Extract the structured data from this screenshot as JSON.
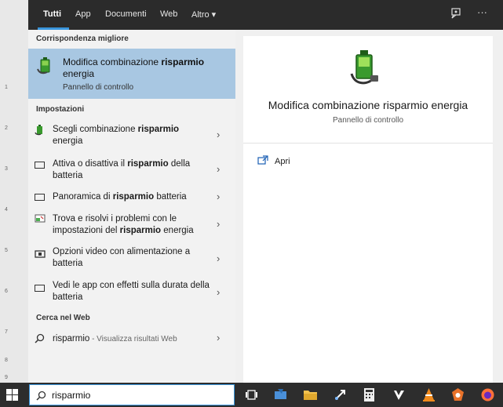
{
  "tabs": [
    "Tutti",
    "App",
    "Documenti",
    "Web",
    "Altro ▾"
  ],
  "best_match": {
    "section": "Corrispondenza migliore",
    "title_pre": "Modifica combinazione ",
    "title_bold": "risparmio",
    "title_post": " energia",
    "subtitle": "Pannello di controllo"
  },
  "settings": {
    "section": "Impostazioni",
    "items": [
      {
        "pre": "Scegli combinazione ",
        "bold": "risparmio",
        "post": " energia",
        "icon": "power-plan-icon"
      },
      {
        "pre": "Attiva o disattiva il ",
        "bold": "risparmio",
        "post": " della batteria",
        "icon": "battery-saver-icon"
      },
      {
        "pre": "Panoramica di ",
        "bold": "risparmio",
        "post": " batteria",
        "icon": "battery-icon"
      },
      {
        "pre": "Trova e risolvi i problemi con le impostazioni del ",
        "bold": "risparmio",
        "post": " energia",
        "icon": "troubleshoot-icon"
      },
      {
        "pre": "Opzioni video con alimentazione a batteria",
        "bold": "",
        "post": "",
        "icon": "video-icon"
      },
      {
        "pre": "Vedi le app con effetti sulla durata della batteria",
        "bold": "",
        "post": "",
        "icon": "battery-usage-icon"
      }
    ]
  },
  "web": {
    "section": "Cerca nel Web",
    "query": "risparmio",
    "suffix": " - Visualizza risultati Web"
  },
  "preview": {
    "title": "Modifica combinazione risparmio energia",
    "subtitle": "Pannello di controllo",
    "action": "Apri"
  },
  "search": {
    "value": "risparmio"
  },
  "ruler_labels": [
    "1",
    "2",
    "3",
    "4",
    "5",
    "6",
    "7",
    "8",
    "9"
  ],
  "colors": {
    "accent": "#3a96dd",
    "selected": "#a8c7e2",
    "topbar": "#2b2b2b",
    "taskbar": "#2d2d2d"
  }
}
